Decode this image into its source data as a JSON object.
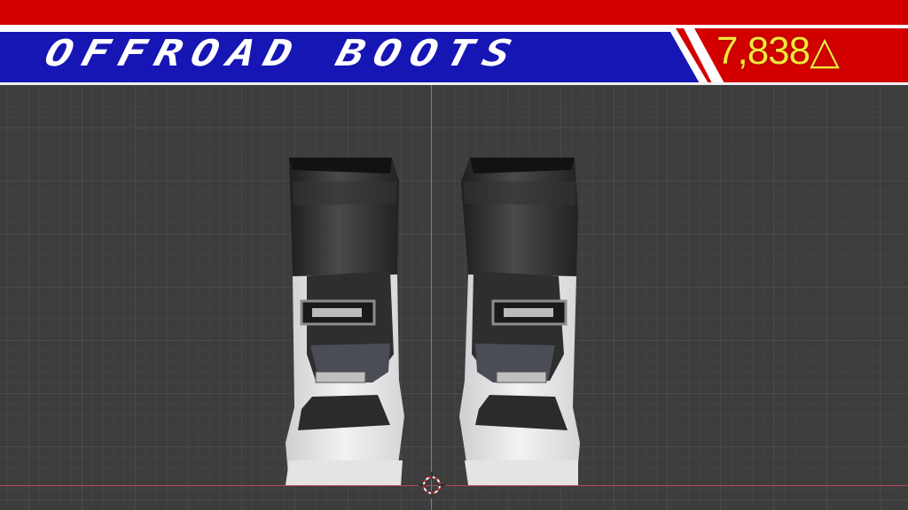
{
  "header": {
    "title": "OFFROAD BOOTS",
    "price": "7,838△"
  },
  "viewport": {
    "subject": "offroad-boots-model",
    "cursor_icon": "3d-cursor-icon"
  },
  "colors": {
    "banner_red": "#d30000",
    "banner_blue": "#1616b4",
    "price_text": "#f5e63a",
    "title_text": "#ffffff",
    "grid_background": "#3d3d3d",
    "axis_z": "#5d86c4",
    "axis_x": "#b64a57"
  }
}
